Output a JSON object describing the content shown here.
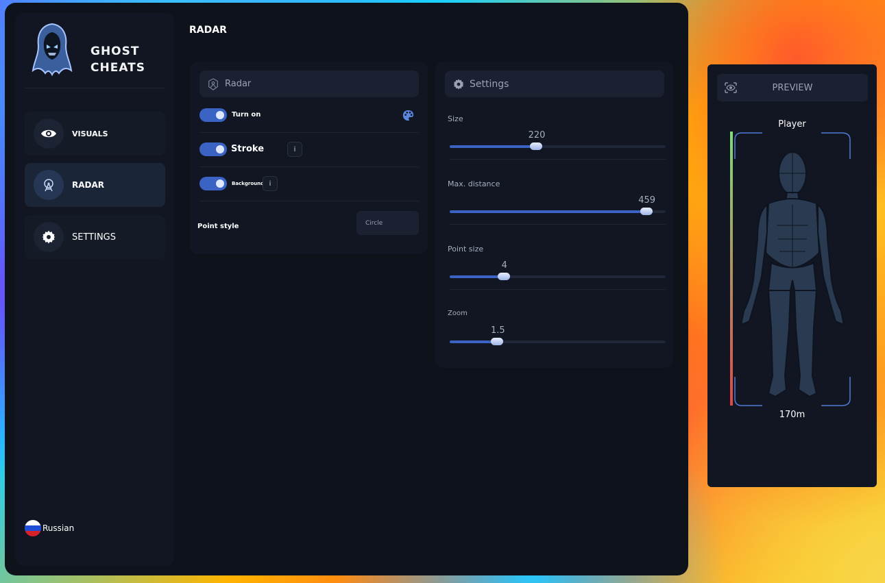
{
  "brand": {
    "line1": "GHOST",
    "line2": "CHEATS"
  },
  "sidebar": {
    "items": [
      {
        "label": "VISUALS",
        "icon": "eye-icon"
      },
      {
        "label": "RADAR",
        "icon": "radar-icon",
        "active": true
      },
      {
        "label": "SETTINGS",
        "icon": "gear-icon"
      }
    ],
    "language": {
      "label": "Russian",
      "flag": "russia-flag-icon"
    }
  },
  "page": {
    "title": "RADAR"
  },
  "radar_card": {
    "header": "Radar",
    "turn_on": {
      "label": "Turn on",
      "enabled": true
    },
    "stroke": {
      "label": "Stroke",
      "enabled": true,
      "info": "i"
    },
    "background": {
      "label": "Background",
      "enabled": true,
      "info": "i"
    },
    "point_style": {
      "label": "Point style",
      "value": "Circle"
    }
  },
  "settings_card": {
    "header": "Settings",
    "sliders": [
      {
        "label": "Size",
        "value": "220",
        "fraction": 0.4
      },
      {
        "label": "Max. distance",
        "value": "459",
        "fraction": 0.91
      },
      {
        "label": "Point size",
        "value": "4",
        "fraction": 0.25
      },
      {
        "label": "Zoom",
        "value": "1.5",
        "fraction": 0.22
      }
    ]
  },
  "preview": {
    "header": "PREVIEW",
    "player_label": "Player",
    "distance": "170m",
    "health_gradient": [
      "#7fdc7a",
      "#e04848"
    ]
  },
  "colors": {
    "accent": "#3b63c4",
    "background": "#0e121b",
    "panel": "#111622"
  }
}
